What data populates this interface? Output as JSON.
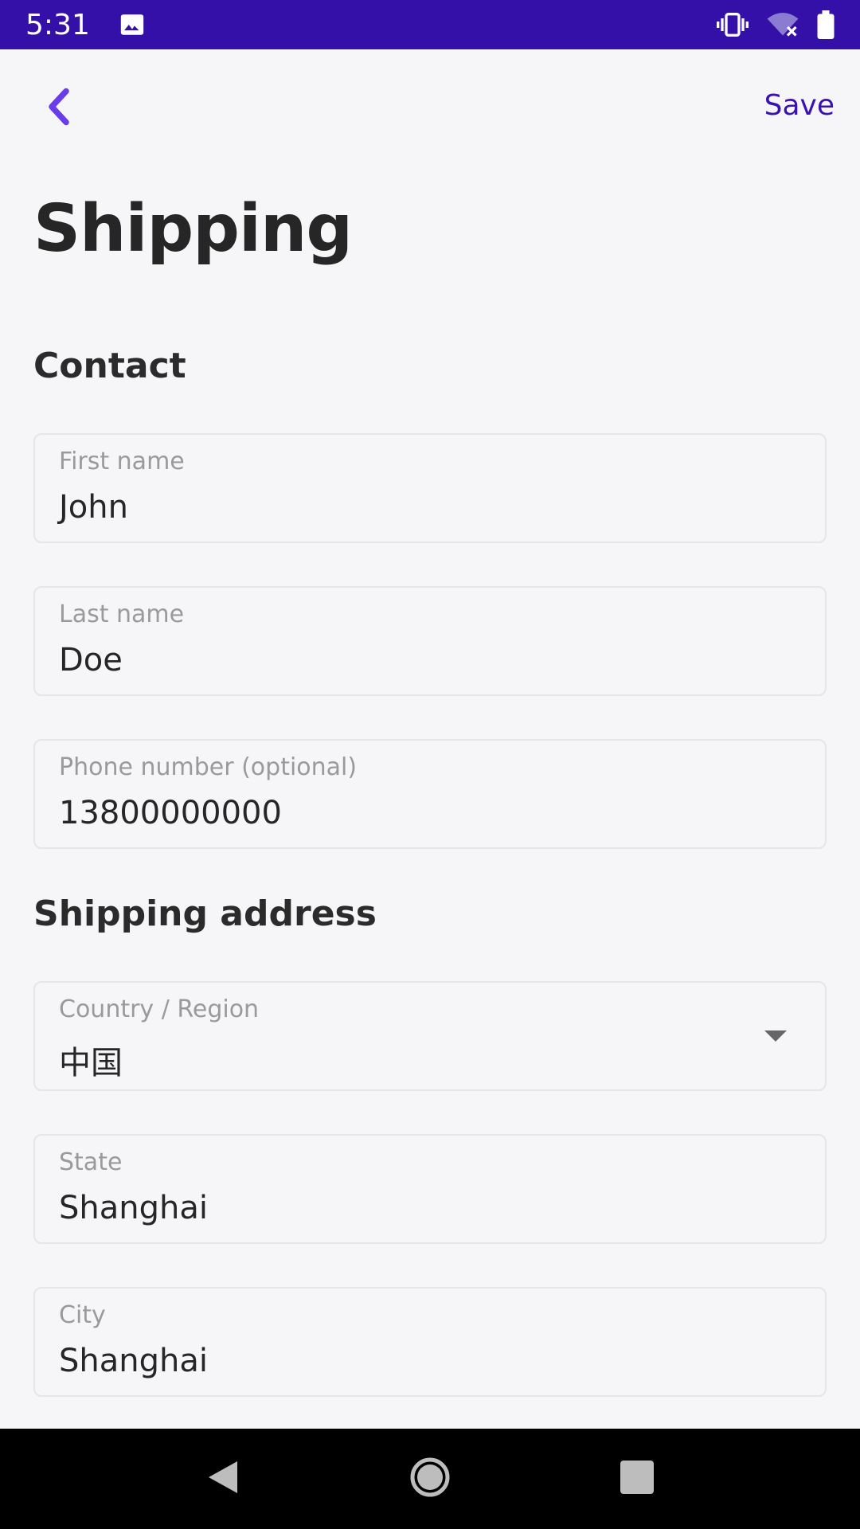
{
  "status_bar": {
    "time": "5:31",
    "left_icon": "image-icon",
    "right_icons": [
      "vibrate-icon",
      "wifi-off-icon",
      "battery-icon"
    ],
    "background_color": "#3510a8"
  },
  "header": {
    "back_icon": "chevron-left-icon",
    "save_label": "Save",
    "accent_color": "#3a12b0"
  },
  "page": {
    "title": "Shipping"
  },
  "contact": {
    "section_title": "Contact",
    "first_name": {
      "label": "First name",
      "value": "John"
    },
    "last_name": {
      "label": "Last name",
      "value": "Doe"
    },
    "phone": {
      "label": "Phone number (optional)",
      "value": "13800000000"
    }
  },
  "address": {
    "section_title": "Shipping address",
    "country": {
      "label": "Country / Region",
      "value": "中国",
      "icon": "dropdown-caret-icon"
    },
    "state": {
      "label": "State",
      "value": "Shanghai"
    },
    "city": {
      "label": "City",
      "value": "Shanghai"
    }
  },
  "nav_bar": {
    "icons": [
      "back-triangle-icon",
      "home-circle-icon",
      "recents-square-icon"
    ]
  }
}
